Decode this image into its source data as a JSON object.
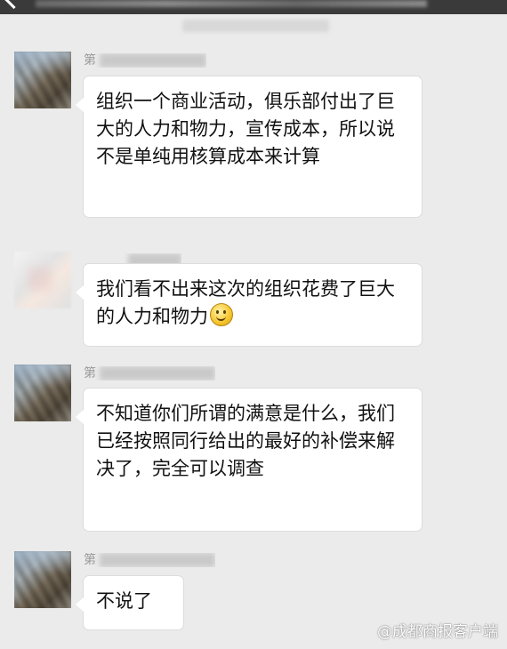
{
  "messages": [
    {
      "sender_visible": "第",
      "text": "组织一个商业活动，俱乐部付出了巨大的人力和物力，宣传成本，所以说不是单纯用核算成本来计算"
    },
    {
      "sender_visible": "",
      "text": "我们看不出来这次的组织花费了巨大的人力和物力",
      "emoji": "smile-icon"
    },
    {
      "sender_visible": "第",
      "text": "不知道你们所谓的满意是什么，我们已经按照同行给出的最好的补偿来解决了，完全可以调查"
    },
    {
      "sender_visible": "第",
      "text": "不说了"
    }
  ],
  "watermark": "@成都商报客户端"
}
